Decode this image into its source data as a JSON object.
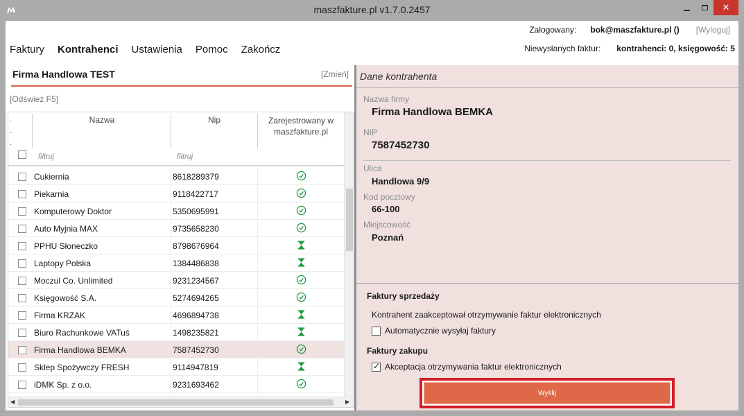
{
  "window": {
    "title": "maszfakture.pl  v1.7.0.2457",
    "close_glyph": "✕"
  },
  "header": {
    "logged_label": "Zalogowany:",
    "logged_value": "bok@maszfakture.pl ()",
    "logout_label": "[Wyloguj]",
    "unsent_label": "Niewysłanych faktur:",
    "unsent_value": "kontrahenci: 0, księgowość: 5"
  },
  "menu": {
    "items": [
      "Faktury",
      "Kontrahenci",
      "Ustawienia",
      "Pomoc",
      "Zakończ"
    ],
    "active": "Kontrahenci"
  },
  "left": {
    "company_name": "Firma Handlowa TEST",
    "change_label": "[Zmień]",
    "refresh_label": "[Odśwież F5]",
    "columns": {
      "name": "Nazwa",
      "nip": "Nip",
      "registered": "Zarejestrowany w maszfakture.pl"
    },
    "filter_placeholder": "filtruj",
    "rows": [
      {
        "name": "Cukiernia",
        "nip": "8618289379",
        "status": "registered"
      },
      {
        "name": "Piekarnia",
        "nip": "9118422717",
        "status": "registered"
      },
      {
        "name": "Komputerowy Doktor",
        "nip": "5350695991",
        "status": "registered"
      },
      {
        "name": "Auto Myjnia MAX",
        "nip": "9735658230",
        "status": "registered"
      },
      {
        "name": "PPHU Słoneczko",
        "nip": "8798676964",
        "status": "pending"
      },
      {
        "name": "Laptopy Polska",
        "nip": "1384486838",
        "status": "pending"
      },
      {
        "name": "Moczul Co. Unlimited",
        "nip": "9231234567",
        "status": "registered"
      },
      {
        "name": "Księgowość S.A.",
        "nip": "5274694265",
        "status": "registered"
      },
      {
        "name": "Firma KRZAK",
        "nip": "4696894738",
        "status": "pending"
      },
      {
        "name": "Biuro Rachunkowe VATuś",
        "nip": "1498235821",
        "status": "pending"
      },
      {
        "name": "Firma Handlowa BEMKA",
        "nip": "7587452730",
        "status": "registered",
        "selected": true
      },
      {
        "name": "Sklep Spożywczy FRESH",
        "nip": "9114947819",
        "status": "pending"
      },
      {
        "name": "iDMK Sp. z o.o.",
        "nip": "9231693462",
        "status": "registered"
      }
    ]
  },
  "details": {
    "title": "Dane kontrahenta",
    "company_label": "Nazwa firmy",
    "company_value": "Firma Handlowa BEMKA",
    "nip_label": "NIP",
    "nip_value": "7587452730",
    "street_label": "Ulica",
    "street_value": "Handlowa 9/9",
    "postal_label": "Kod pocztowy",
    "postal_value": "66-100",
    "city_label": "Miejscowość",
    "city_value": "Poznań",
    "sales_title": "Faktury sprzedaży",
    "sales_note": "Kontrahent zaakceptował otrzymywanie faktur elektronicznych",
    "auto_send_label": "Automatycznie wysyłaj faktury",
    "auto_send_checked": false,
    "purchase_title": "Faktury zakupu",
    "accept_label": "Akceptacja otrzymywania faktur elektronicznych",
    "accept_checked": true,
    "send_label": "Wyślij"
  },
  "colors": {
    "accent": "#df6849",
    "highlight_frame": "#d21e28",
    "status_ok": "#1a9a3a",
    "selected_row": "#efe2e1",
    "details_bg": "#f0e1df"
  },
  "icons": {
    "registered": "check-circle-icon",
    "pending": "hourglass-icon"
  }
}
